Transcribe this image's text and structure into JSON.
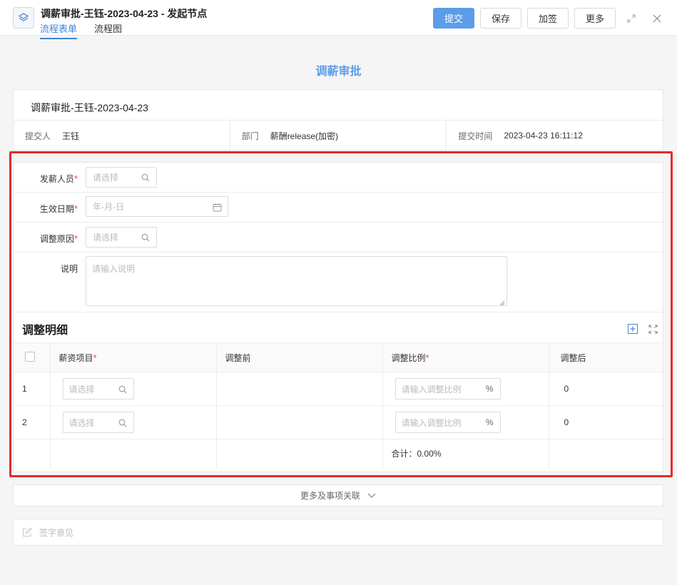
{
  "header": {
    "title": "调薪审批-王钰-2023-04-23 - 发起节点",
    "tabs": [
      {
        "label": "流程表单",
        "active": true
      },
      {
        "label": "流程图",
        "active": false
      }
    ],
    "buttons": {
      "submit": "提交",
      "save": "保存",
      "add_sign": "加签",
      "more": "更多"
    },
    "icons": {
      "app": "layers-icon",
      "expand": "expand-icon",
      "close": "close-icon"
    },
    "accent_color": "#5b9de8"
  },
  "form": {
    "heading": "调薪审批",
    "doc_title": "调薪审批-王钰-2023-04-23",
    "info": {
      "submitter_label": "提交人",
      "submitter": "王钰",
      "department_label": "部门",
      "department": "薪酬release(加密)",
      "submit_time_label": "提交时间",
      "submit_time": "2023-04-23 16:11:12"
    },
    "fields": {
      "payroll_person": {
        "label": "发薪人员",
        "required_mark": "*",
        "placeholder": "请选择"
      },
      "effective_date": {
        "label": "生效日期",
        "required_mark": "*",
        "placeholder": "年-月-日"
      },
      "adjust_reason": {
        "label": "调整原因",
        "required_mark": "*",
        "placeholder": "请选择"
      },
      "description": {
        "label": "说明",
        "placeholder": "请输入说明"
      }
    },
    "highlight_color": "#e52a2a"
  },
  "detail": {
    "title": "调整明细",
    "columns": {
      "salary_item": "薪资项目",
      "before": "调整前",
      "ratio": "调整比例",
      "after": "调整后",
      "required_mark": "*"
    },
    "rows": [
      {
        "index": "1",
        "salary_item_placeholder": "请选择",
        "before": "",
        "ratio_placeholder": "请输入调整比例",
        "unit": "%",
        "after": "0"
      },
      {
        "index": "2",
        "salary_item_placeholder": "请选择",
        "before": "",
        "ratio_placeholder": "请输入调整比例",
        "unit": "%",
        "after": "0"
      }
    ],
    "summary": "合计：0.00%"
  },
  "footer": {
    "more_label": "更多及事项关联",
    "sign_placeholder": "签字意见"
  }
}
